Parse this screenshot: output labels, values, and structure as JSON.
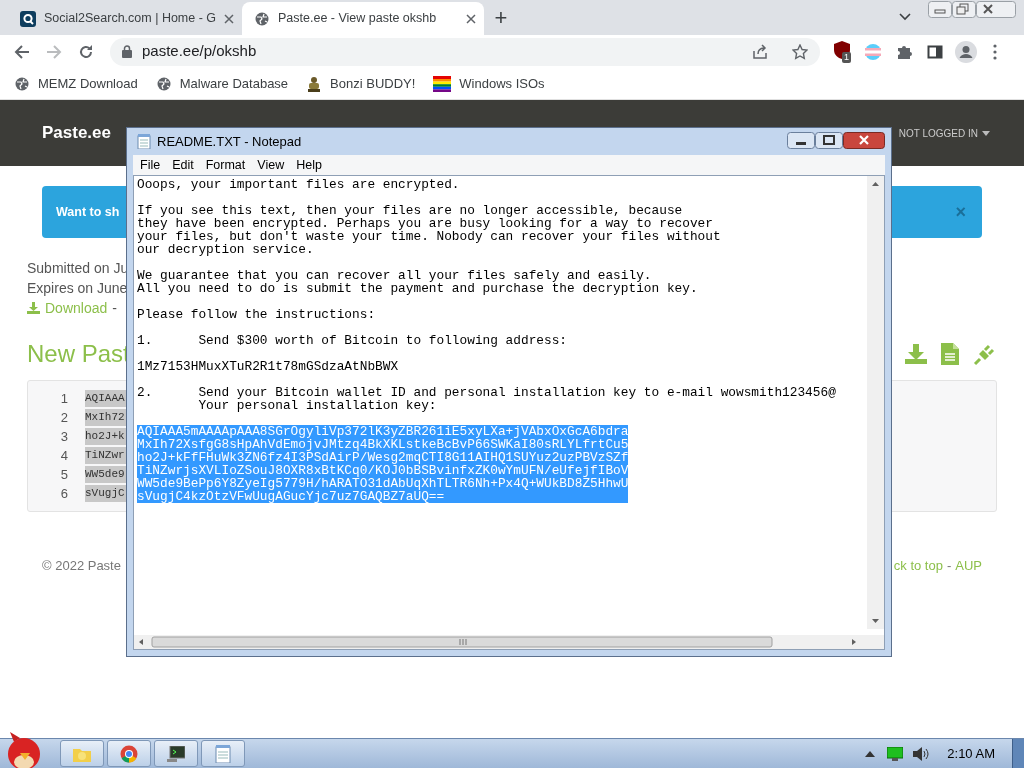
{
  "browser": {
    "tabs": [
      {
        "title": "Social2Search.com | Home - G",
        "kind": "search",
        "selected": false
      },
      {
        "title": "Paste.ee - View paste okshb",
        "kind": "globe",
        "selected": true
      }
    ],
    "new_tab": "+",
    "address": "paste.ee/p/okshb",
    "extension_badge": "1",
    "bookmarks": [
      {
        "label": "MEMZ Download",
        "kind": "globe"
      },
      {
        "label": "Malware Database",
        "kind": "globe"
      },
      {
        "label": "Bonzi BUDDY!",
        "kind": "figure"
      },
      {
        "label": "Windows ISOs",
        "kind": "rainbow"
      }
    ]
  },
  "page": {
    "brand": "Paste.ee",
    "account": "NOT LOGGED IN",
    "alert": {
      "text": "Want to sh",
      "close": "×"
    },
    "meta": [
      "Submitted on Ju",
      "Expires on June"
    ],
    "download": "Download",
    "download_sep": "-",
    "heading": "New Past",
    "code_lines": [
      {
        "number": "1",
        "text": "AQIAAA"
      },
      {
        "number": "2",
        "text": "MxIh72"
      },
      {
        "number": "3",
        "text": "ho2J+k"
      },
      {
        "number": "4",
        "text": "TiNZwr"
      },
      {
        "number": "5",
        "text": "WW5de9"
      },
      {
        "number": "6",
        "text": "sVugjC"
      }
    ],
    "footer_left": "© 2022 Paste",
    "footer_right": "ck to top",
    "footer_sep": "-",
    "footer_link": "AUP"
  },
  "notepad": {
    "title": "README.TXT - Notepad",
    "menu": [
      "File",
      "Edit",
      "Format",
      "View",
      "Help"
    ],
    "paragraphs": [
      {
        "lines": [
          "Ooops, your important files are encrypted."
        ],
        "selected": false
      },
      {
        "lines": [
          "If you see this text, then your files are no longer accessible, because",
          "they have been encrypted. Perhaps you are busy looking for a way to recover",
          "your files, but don't waste your time. Nobody can recover your files without",
          "our decryption service."
        ],
        "selected": false
      },
      {
        "lines": [
          "We guarantee that you can recover all your files safely and easily.",
          "All you need to do is submit the payment and purchase the decryption key."
        ],
        "selected": false
      },
      {
        "lines": [
          "Please follow the instructions:"
        ],
        "selected": false
      },
      {
        "lines": [
          "1.      Send $300 worth of Bitcoin to following address:"
        ],
        "selected": false
      },
      {
        "lines": [
          "1Mz7153HMuxXTuR2R1t78mGSdzaAtNbBWX"
        ],
        "selected": false
      },
      {
        "lines": [
          "2.      Send your Bitcoin wallet ID and personal installation key to e-mail wowsmith123456@",
          "        Your personal installation key:"
        ],
        "selected": false
      },
      {
        "lines": [
          "AQIAAA5mAAAApAAA8SGrOgyliVp372lK3yZBR261iE5xyLXa+jVAbxOxGcA6bdra",
          "MxIh72XsfgG8sHpAhVdEmojvJMtzq4BkXKLstkeBcBvP66SWKaI80sRLYLfrtCu5",
          "ho2J+kFfFHuWk3ZN6fz4I3PSdAirP/Wesg2mqCTI8G11AIHQ1SUYuz2uzPBVzSZf",
          "TiNZwrjsXVLIoZSouJ8OXR8xBtKCq0/KOJ0bBSBvinfxZK0wYmUFN/eUfejfIBoV",
          "WW5de9BePp6Y8ZyeIg5779H/hARATO31dAbUqXhTLTR6Nh+Px4Q+WUkBD8Z5HhwU",
          "sVugjC4kzOtzVFwUugAGucYjc7uz7GAQBZ7aUQ=="
        ],
        "selected": true
      }
    ]
  },
  "taskbar": {
    "buttons": [
      {
        "kind": "folder"
      },
      {
        "kind": "chrome"
      },
      {
        "kind": "terminal"
      },
      {
        "kind": "notepad"
      }
    ],
    "time": "2:10 AM"
  }
}
